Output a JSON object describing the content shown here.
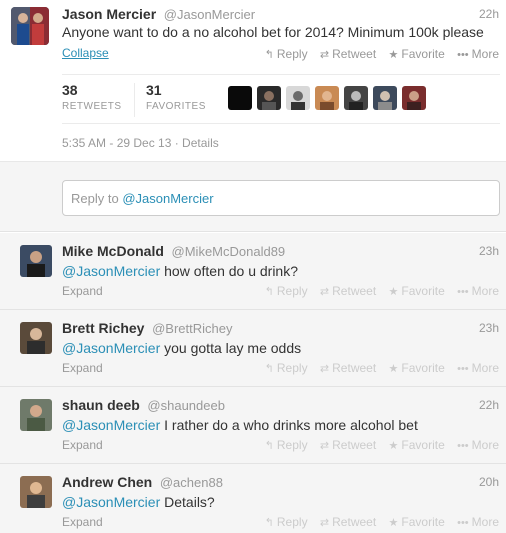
{
  "main_tweet": {
    "fullname": "Jason Mercier",
    "screen_name": "@JasonMercier",
    "time": "22h",
    "text": "Anyone want to do a no alcohol bet for 2014? Minimum 100k please",
    "collapse": "Collapse",
    "actions": {
      "reply": "Reply",
      "retweet": "Retweet",
      "favorite": "Favorite",
      "more": "More"
    },
    "retweets_count": "38",
    "retweets_label": "RETWEETS",
    "favorites_count": "31",
    "favorites_label": "FAVORITES",
    "meta": "5:35 AM - 29 Dec 13 · Details"
  },
  "reply_box": {
    "prefix": "Reply to ",
    "mention": "@JasonMercier"
  },
  "replies": [
    {
      "fullname": "Mike McDonald",
      "screen_name": "@MikeMcDonald89",
      "time": "23h",
      "mention": "@JasonMercier",
      "text": " how often do u drink?",
      "expand": "Expand"
    },
    {
      "fullname": "Brett Richey",
      "screen_name": "@BrettRichey",
      "time": "23h",
      "mention": "@JasonMercier",
      "text": " you gotta lay me odds",
      "expand": "Expand"
    },
    {
      "fullname": "shaun deeb",
      "screen_name": "@shaundeeb",
      "time": "22h",
      "mention": "@JasonMercier",
      "text": " I rather do a who drinks more alcohol bet",
      "expand": "Expand"
    },
    {
      "fullname": "Andrew Chen",
      "screen_name": "@achen88",
      "time": "20h",
      "mention": "@JasonMercier",
      "text": " Details?",
      "expand": "Expand"
    }
  ],
  "reply_actions": {
    "reply": "Reply",
    "retweet": "Retweet",
    "favorite": "Favorite",
    "more": "More"
  },
  "colors": {
    "link": "#2b8fb6",
    "muted": "#999999",
    "text": "#333333",
    "background": "#f5f5f5"
  }
}
